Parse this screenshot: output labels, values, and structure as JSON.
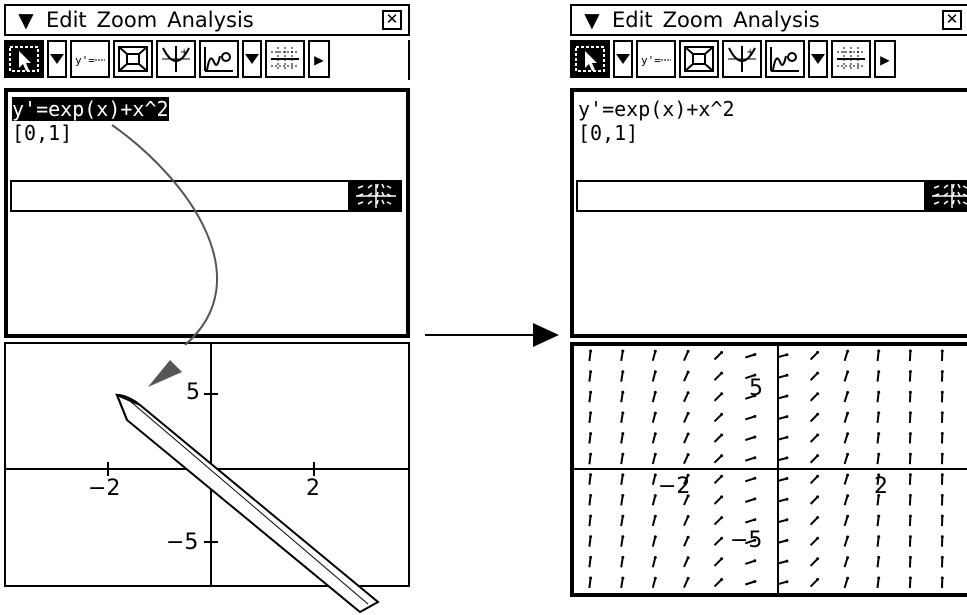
{
  "menu": {
    "icon": "chevron-down-icon",
    "items": [
      "Edit",
      "Zoom",
      "Analysis"
    ],
    "close": "✕"
  },
  "editor": {
    "line1": "y'=exp(x)+x^2",
    "line2": "[0,1]"
  },
  "graph_left": {
    "x_ticks": [
      "−2",
      "2"
    ],
    "y_ticks": [
      "5",
      "−5"
    ]
  },
  "graph_right": {
    "x_ticks": [
      "−2",
      "2"
    ],
    "y_ticks": [
      "5",
      "−5"
    ]
  },
  "colors": {
    "foreground": "#000000",
    "background": "#ffffff",
    "stroke": "#555555"
  }
}
